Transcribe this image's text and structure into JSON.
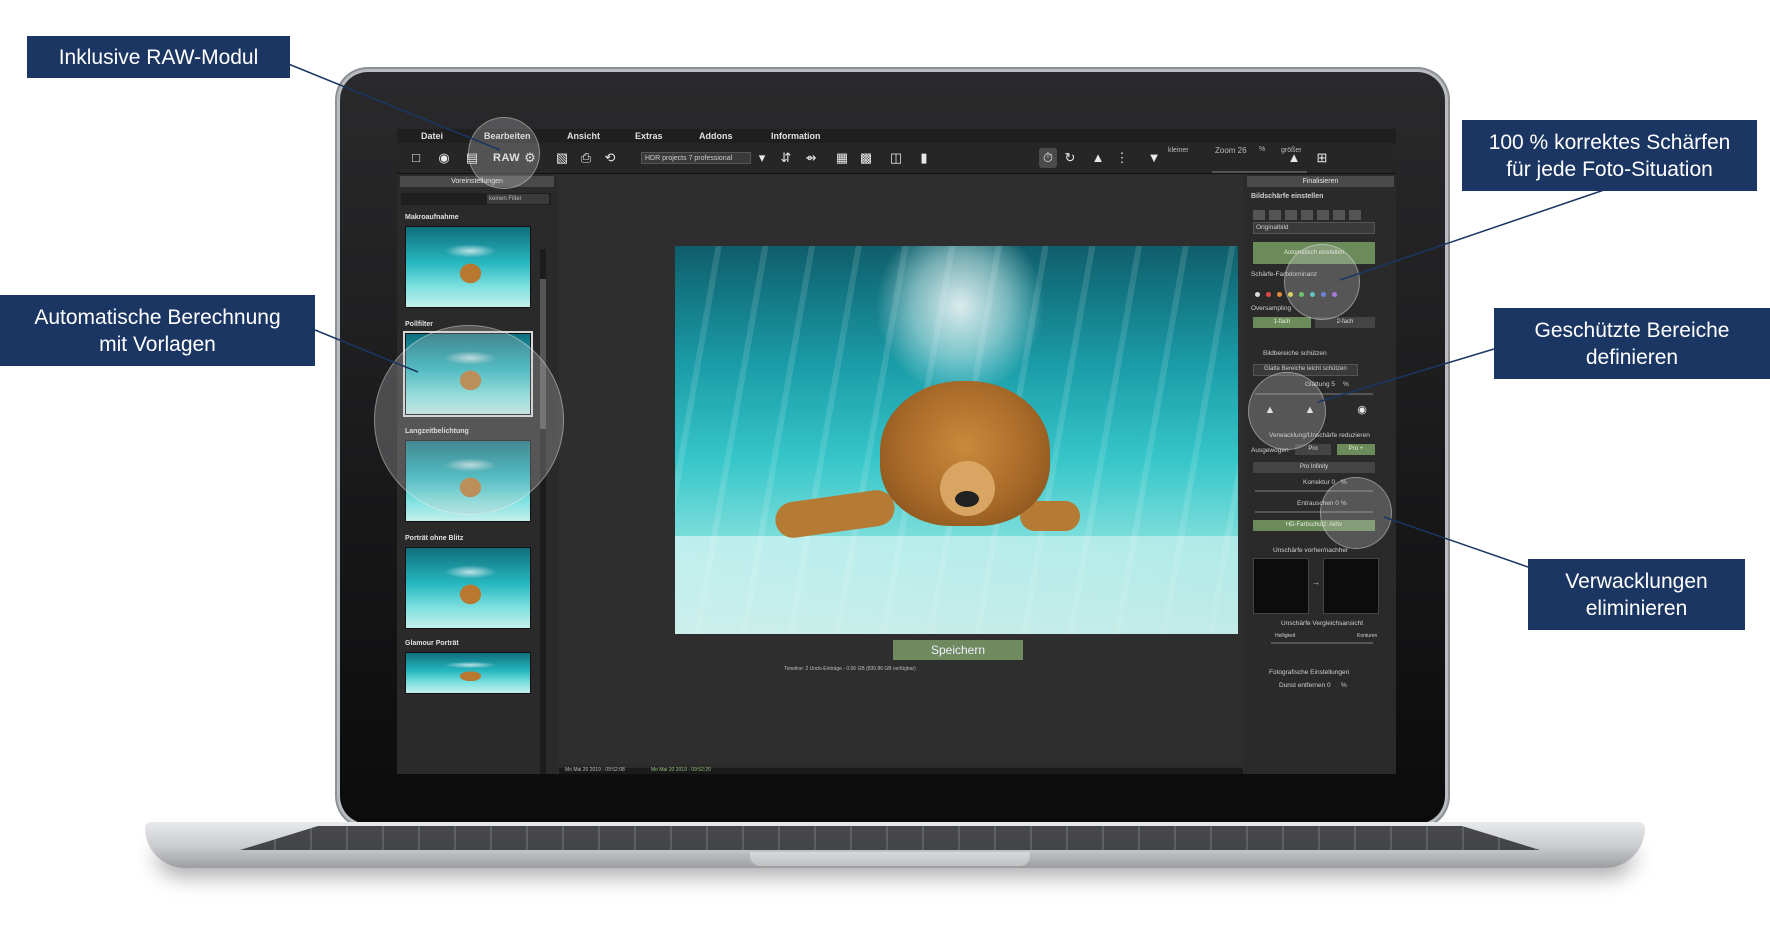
{
  "callouts": {
    "raw_module": "Inklusive RAW-Modul",
    "auto_calc_line1": "Automatische Berechnung",
    "auto_calc_line2": "mit Vorlagen",
    "sharpen_line1": "100 % korrektes Schärfen",
    "sharpen_line2": "für jede Foto-Situation",
    "protected_line1": "Geschützte Bereiche",
    "protected_line2": "definieren",
    "shake_line1": "Verwacklungen",
    "shake_line2": "eliminieren"
  },
  "menu": [
    "Datei",
    "Bearbeiten",
    "Ansicht",
    "Extras",
    "Addons",
    "Information"
  ],
  "toolbar": {
    "raw_label": "RAW",
    "preset_select": "HDR projects 7 professional",
    "zoom_label": "Zoom 26",
    "zoom_unit": "%",
    "zoom_smaller": "kleiner",
    "zoom_larger": "größer"
  },
  "left_panel": {
    "header": "Voreinstellungen",
    "filter_select": "keinen Filter",
    "presets": [
      "Makroaufnahme",
      "Pollfilter",
      "Langzeitbelichtung",
      "Porträt ohne Blitz",
      "Glamour Porträt"
    ]
  },
  "center": {
    "save_button": "Speichern",
    "status_info": "Timeline: 2 Undo-Einträge - 0.06 GB (830.86 GB verfügbar)",
    "timestamp_1": "Mo Mai 20 2019 - 09:52:08",
    "timestamp_2": "Mo Mai 20 2019 - 09:52:20"
  },
  "right_panel": {
    "header": "Finalisieren",
    "sharpness_title": "Bildschärfe einstellen",
    "source_select": "Originalbild",
    "auto_button": "Automatisch einstellen",
    "color_dominance": "Schärfe-Farbdominanz",
    "oversampling": "Oversampling",
    "over_1x": "1-fach",
    "over_2x": "2-fach",
    "protect_title": "Bildbereiche schützen",
    "protect_select": "Glatte Bereiche leicht schützen",
    "smoothing_label": "Glättung 5",
    "smoothing_unit": "%",
    "shake_title": "Verwacklung/Unschärfe reduzieren",
    "mode_balanced": "Ausgewogen",
    "mode_pro": "Pro",
    "mode_pro_plus": "Pro +",
    "mode_infinity": "Pro Infinity",
    "correction_label": "Korrektur 0",
    "correction_unit": "%",
    "noise_label": "Entrauschen 0",
    "noise_unit": "%",
    "hd_color": "HD-Farbschutz: Aktiv",
    "before_after": "Unschärfe vorher/nachher",
    "compare_view": "Unschärfe Vergleichsansicht",
    "brightness": "Helligkeit",
    "contours": "Konturen",
    "photo_settings": "Fotografische Einstellungen",
    "dust_label": "Dunst entfernen 0",
    "dust_unit": "%"
  },
  "colors": {
    "callout_bg": "#1b3663",
    "accent_green": "#6b8b5a",
    "ui_dark": "#2b2b2b"
  }
}
